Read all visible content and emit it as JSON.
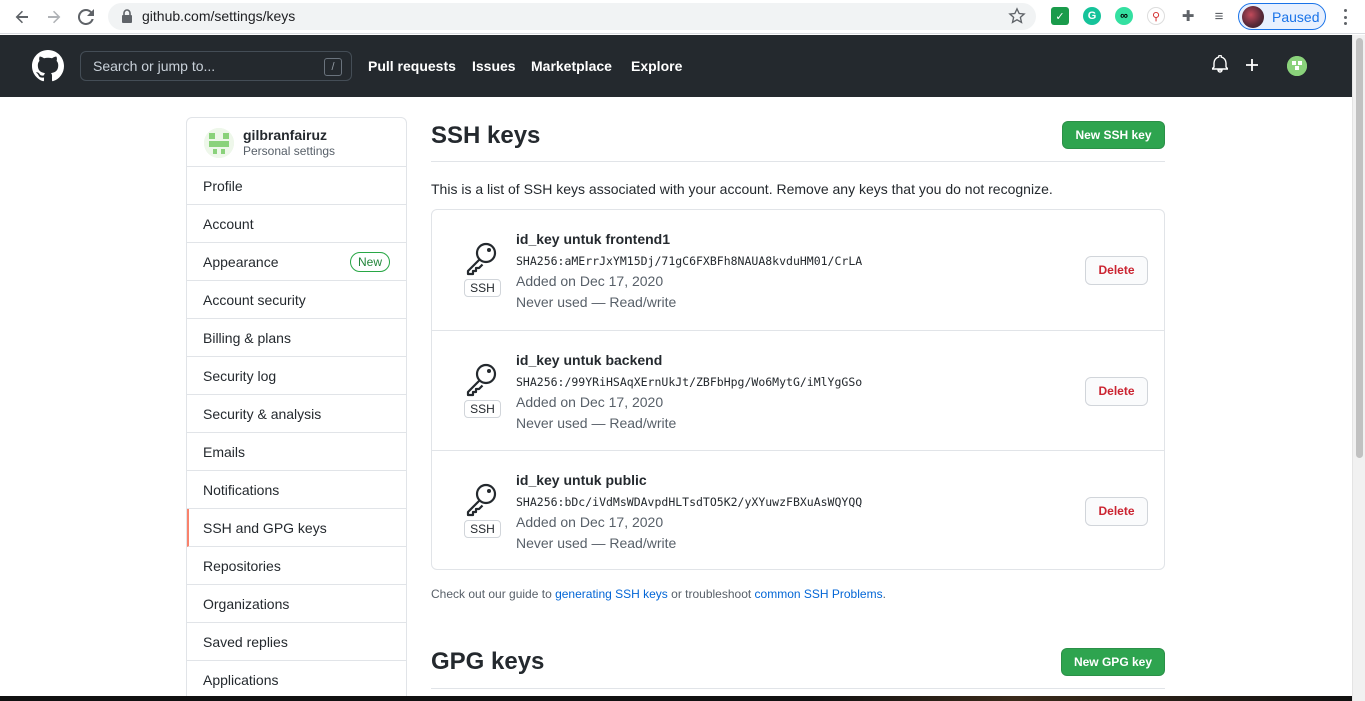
{
  "browser": {
    "url": "github.com/settings/keys",
    "profile_label": "Paused",
    "extensions": [
      "shield-extension-icon",
      "grammarly-extension-icon",
      "tripadvisor-extension-icon",
      "bike-extension-icon",
      "puzzle-extensions-icon",
      "media-queue-icon"
    ]
  },
  "header": {
    "search_placeholder": "Search or jump to...",
    "search_shortcut": "/",
    "nav": [
      "Pull requests",
      "Issues",
      "Marketplace",
      "Explore"
    ]
  },
  "sidebar": {
    "username": "gilbranfairuz",
    "subtitle": "Personal settings",
    "items": [
      {
        "label": "Profile"
      },
      {
        "label": "Account"
      },
      {
        "label": "Appearance",
        "badge": "New"
      },
      {
        "label": "Account security"
      },
      {
        "label": "Billing & plans"
      },
      {
        "label": "Security log"
      },
      {
        "label": "Security & analysis"
      },
      {
        "label": "Emails"
      },
      {
        "label": "Notifications"
      },
      {
        "label": "SSH and GPG keys",
        "active": true
      },
      {
        "label": "Repositories"
      },
      {
        "label": "Organizations"
      },
      {
        "label": "Saved replies"
      },
      {
        "label": "Applications"
      }
    ]
  },
  "main": {
    "title": "SSH keys",
    "new_ssh_button": "New SSH key",
    "intro": "This is a list of SSH keys associated with your account. Remove any keys that you do not recognize.",
    "keys": [
      {
        "title": "id_key untuk frontend1",
        "fingerprint": "SHA256:aMErrJxYM15Dj/71gC6FXBFh8NAUA8kvduHM01/CrLA",
        "added": "Added on Dec 17, 2020",
        "usage": "Never used — Read/write",
        "type": "SSH",
        "delete": "Delete"
      },
      {
        "title": "id_key untuk backend",
        "fingerprint": "SHA256:/99YRiHSAqXErnUkJt/ZBFbHpg/Wo6MytG/iMlYgGSo",
        "added": "Added on Dec 17, 2020",
        "usage": "Never used — Read/write",
        "type": "SSH",
        "delete": "Delete"
      },
      {
        "title": "id_key untuk public",
        "fingerprint": "SHA256:bDc/iVdMsWDAvpdHLTsdTO5K2/yXYuwzFBXuAsWQYQQ",
        "added": "Added on Dec 17, 2020",
        "usage": "Never used — Read/write",
        "type": "SSH",
        "delete": "Delete"
      }
    ],
    "guide": {
      "prefix": "Check out our guide to ",
      "link1": "generating SSH keys",
      "middle": " or troubleshoot ",
      "link2": "common SSH Problems",
      "suffix": "."
    },
    "gpg_title": "GPG keys",
    "new_gpg_button": "New GPG key"
  }
}
